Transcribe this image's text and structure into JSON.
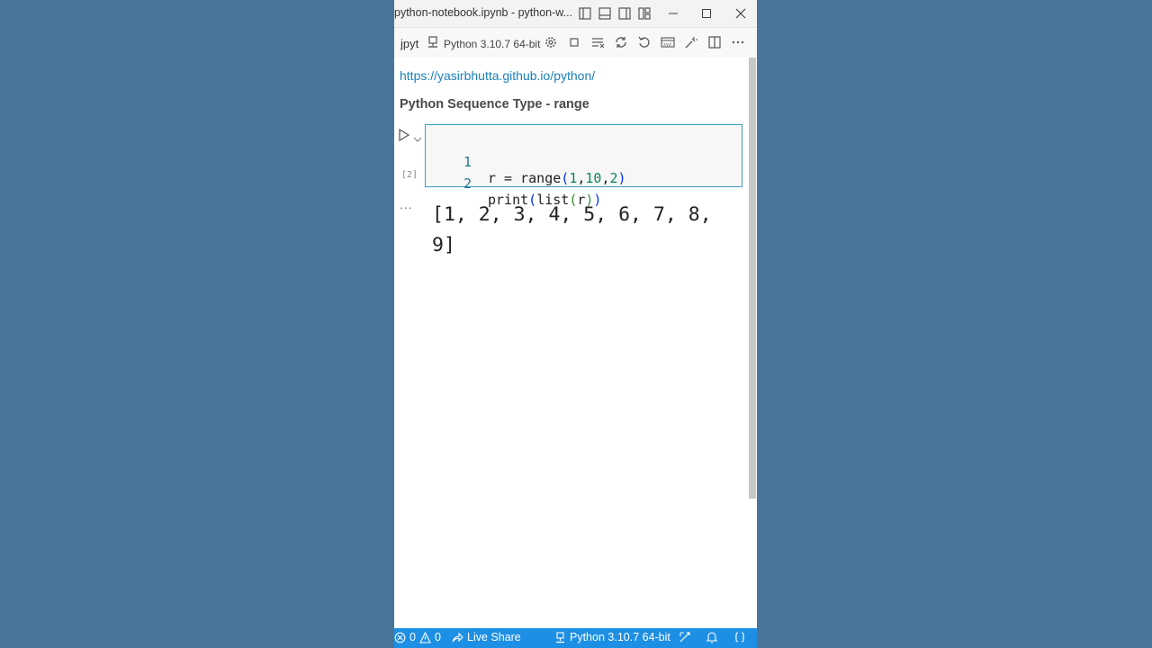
{
  "window": {
    "title": "python-notebook.ipynb - python-w..."
  },
  "toolbar": {
    "tab_fragment": "jpyt",
    "kernel_label": "Python 3.10.7 64-bit",
    "icons": [
      "gear-icon",
      "stop-icon",
      "clear-outputs-icon",
      "restart-icon",
      "undo-icon",
      "variables-icon",
      "outline-icon",
      "split-editor-icon",
      "more-icon"
    ]
  },
  "notebook": {
    "link": "https://yasirbhutta.github.io/python/",
    "heading": "Python Sequence Type - range",
    "cell": {
      "execution_count": "[2]",
      "lines": [
        {
          "number": "1"
        },
        {
          "number": "2"
        }
      ]
    },
    "output_marker": "...",
    "output": "[1, 2, 3, 4, 5, 6, 7, 8, 9]"
  },
  "statusbar": {
    "errors": "0",
    "warnings": "0",
    "live_share": "Live Share",
    "kernel": "Python 3.10.7 64-bit"
  },
  "colors": {
    "background": "#487599",
    "statusbar": "#1d8fe4",
    "cell_border": "#3c9fc4",
    "link": "#1a7fb8"
  }
}
